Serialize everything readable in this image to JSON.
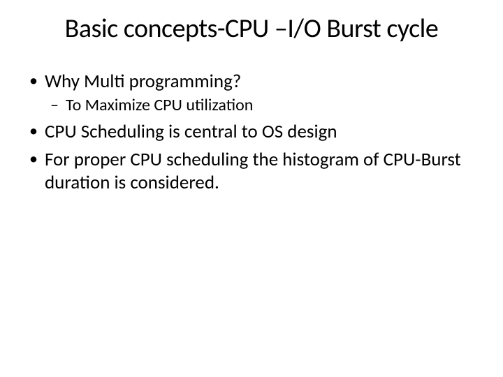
{
  "title": "Basic concepts-CPU –I/O Burst cycle",
  "bullets": {
    "b1": "Why Multi programming?",
    "b1_sub1": "To Maximize CPU utilization",
    "b2": "CPU Scheduling is central to OS design",
    "b3": "For proper CPU scheduling the histogram of CPU-Burst duration is considered."
  }
}
